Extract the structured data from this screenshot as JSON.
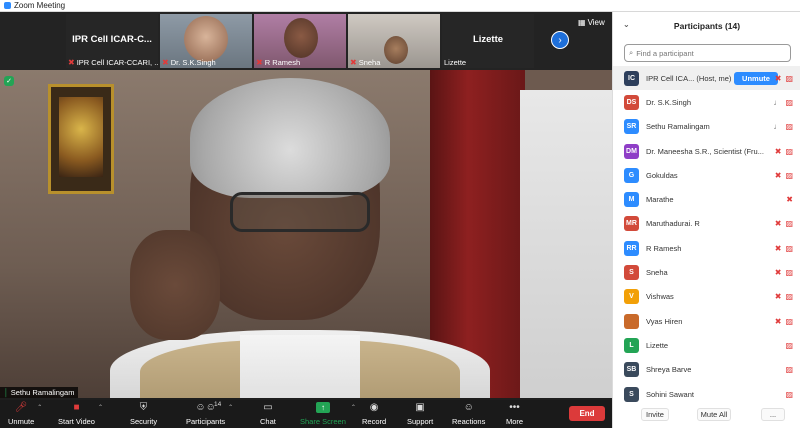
{
  "window": {
    "title": "Zoom Meeting"
  },
  "gallery": {
    "tiles": [
      {
        "big": "IPR Cell ICAR-C...",
        "name": "IPR Cell ICAR-CCARI, ...",
        "muted": true
      },
      {
        "big": "",
        "name": "Dr. S.K.Singh",
        "muted": true
      },
      {
        "big": "",
        "name": "R Ramesh",
        "muted": true
      },
      {
        "big": "",
        "name": "Sneha",
        "muted": true
      },
      {
        "big": "Lizette",
        "name": "Lizette",
        "muted": false
      }
    ],
    "view_label": "View"
  },
  "main": {
    "speaker": "Sethu Ramalingam"
  },
  "toolbar": {
    "unmute": "Unmute",
    "start_video": "Start Video",
    "security": "Security",
    "participants": "Participants",
    "participants_count": "14",
    "chat": "Chat",
    "share_screen": "Share Screen",
    "record": "Record",
    "support": "Support",
    "reactions": "Reactions",
    "more": "More",
    "end": "End"
  },
  "panel": {
    "title": "Participants (14)",
    "search_placeholder": "Find a participant",
    "participants": [
      {
        "initials": "IC",
        "color": "#2e3f5c",
        "name": "IPR Cell ICA... (Host, me)",
        "mic": "off",
        "video": "off",
        "unmute": "Unmute"
      },
      {
        "initials": "DS",
        "color": "#d24a3a",
        "name": "Dr. S.K.Singh",
        "mic": "on",
        "video": "off"
      },
      {
        "initials": "SR",
        "color": "#2d8cff",
        "name": "Sethu Ramalingam",
        "mic": "on",
        "video": "off"
      },
      {
        "initials": "DM",
        "color": "#8f3ec7",
        "name": "Dr. Maneesha S.R., Scientist (Fru...",
        "mic": "off",
        "video": "off"
      },
      {
        "initials": "G",
        "color": "#2d8cff",
        "name": "Gokuldas",
        "mic": "off",
        "video": "off"
      },
      {
        "initials": "M",
        "color": "#2d8cff",
        "name": "Marathe",
        "mic": "off",
        "video": "none"
      },
      {
        "initials": "MR",
        "color": "#d24a3a",
        "name": "Maruthadurai. R",
        "mic": "off",
        "video": "off"
      },
      {
        "initials": "RR",
        "color": "#2d8cff",
        "name": "R Ramesh",
        "mic": "off",
        "video": "off"
      },
      {
        "initials": "S",
        "color": "#d24a3a",
        "name": "Sneha",
        "mic": "off",
        "video": "off"
      },
      {
        "initials": "V",
        "color": "#f2a007",
        "name": "Vishwas",
        "mic": "off",
        "video": "off"
      },
      {
        "initials": "",
        "color": "#c96a2a",
        "name": "Vyas Hiren",
        "mic": "off",
        "video": "off"
      },
      {
        "initials": "L",
        "color": "#23a455",
        "name": "Lizette",
        "mic": "none",
        "video": "off"
      },
      {
        "initials": "SB",
        "color": "#3a4a5c",
        "name": "Shreya Barve",
        "mic": "none",
        "video": "off"
      },
      {
        "initials": "S",
        "color": "#3a4a5c",
        "name": "Sohini Sawant",
        "mic": "none",
        "video": "off"
      }
    ],
    "footer": {
      "invite": "Invite",
      "mute_all": "Mute All",
      "more": "..."
    }
  }
}
